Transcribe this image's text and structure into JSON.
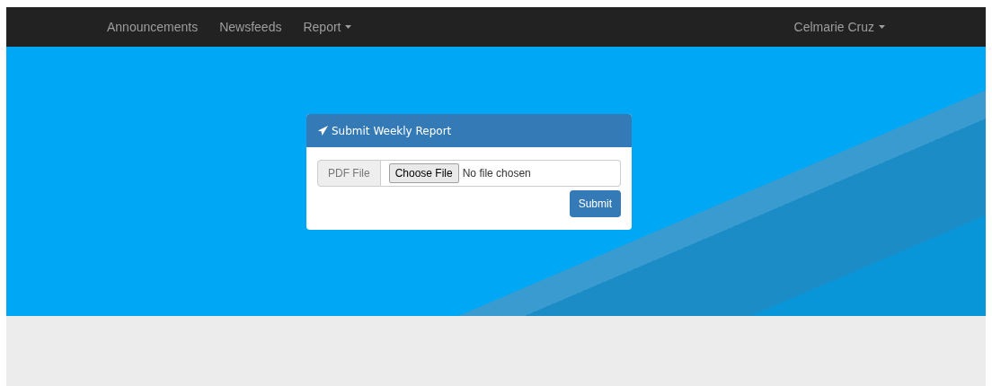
{
  "navbar": {
    "links": [
      {
        "label": "Announcements",
        "dropdown": false
      },
      {
        "label": "Newsfeeds",
        "dropdown": false
      },
      {
        "label": "Report",
        "dropdown": true
      }
    ],
    "user": {
      "label": "Celmarie Cruz",
      "dropdown": true
    }
  },
  "panel": {
    "title": "Submit Weekly Report",
    "addon": "PDF File",
    "choose_button": "Choose File",
    "file_status": "No file chosen",
    "submit": "Submit"
  }
}
